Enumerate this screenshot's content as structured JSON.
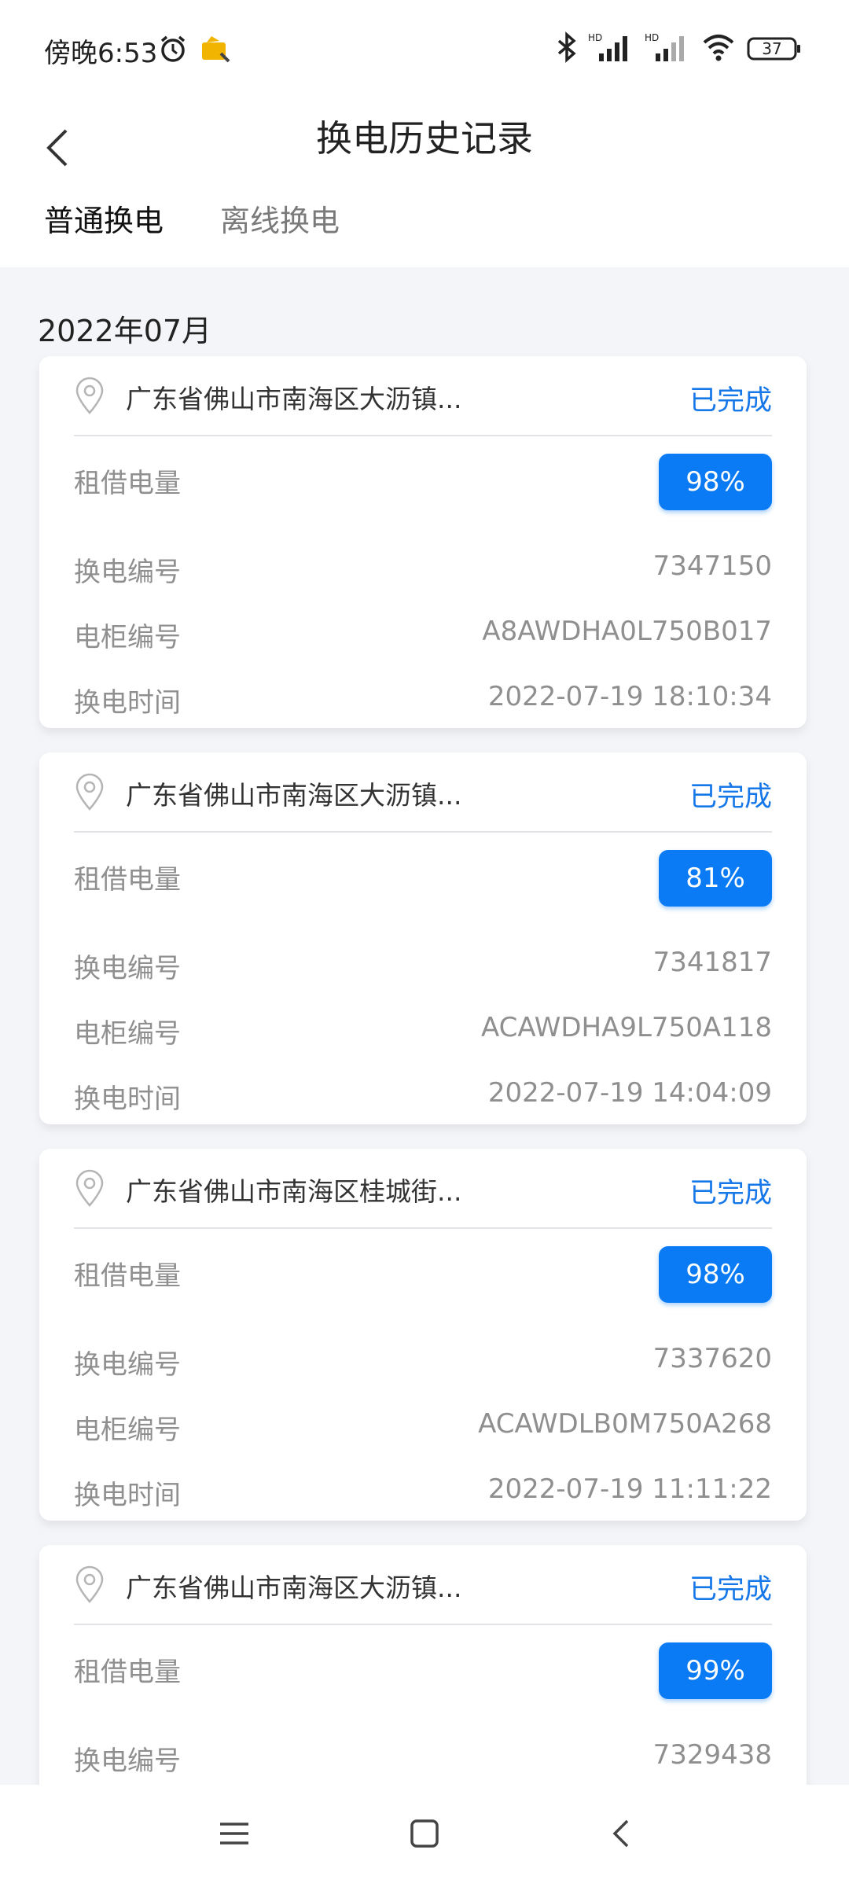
{
  "status_bar": {
    "time": "傍晚6:53",
    "battery": "37",
    "icons": [
      "alarm-icon",
      "app-notification-icon",
      "bluetooth-icon",
      "hd-signal-icon",
      "hd-signal-icon",
      "wifi-icon",
      "battery-icon"
    ]
  },
  "header": {
    "title": "换电历史记录",
    "tabs": [
      {
        "label": "普通换电",
        "active": true
      },
      {
        "label": "离线换电",
        "active": false
      }
    ]
  },
  "month": "2022年07月",
  "records": [
    {
      "address": "广东省佛山市南海区大沥镇...",
      "status": "已完成",
      "rent_label": "租借电量",
      "rent_value": "98%",
      "swap_no_label": "换电编号",
      "swap_no": "7347150",
      "cabinet_label": "电柜编号",
      "cabinet_no": "A8AWDHA0L750B017",
      "time_label": "换电时间",
      "time": "2022-07-19 18:10:34"
    },
    {
      "address": "广东省佛山市南海区大沥镇...",
      "status": "已完成",
      "rent_label": "租借电量",
      "rent_value": "81%",
      "swap_no_label": "换电编号",
      "swap_no": "7341817",
      "cabinet_label": "电柜编号",
      "cabinet_no": "ACAWDHA9L750A118",
      "time_label": "换电时间",
      "time": "2022-07-19 14:04:09"
    },
    {
      "address": "广东省佛山市南海区桂城街...",
      "status": "已完成",
      "rent_label": "租借电量",
      "rent_value": "98%",
      "swap_no_label": "换电编号",
      "swap_no": "7337620",
      "cabinet_label": "电柜编号",
      "cabinet_no": "ACAWDLB0M750A268",
      "time_label": "换电时间",
      "time": "2022-07-19 11:11:22"
    },
    {
      "address": "广东省佛山市南海区大沥镇...",
      "status": "已完成",
      "rent_label": "租借电量",
      "rent_value": "99%",
      "swap_no_label": "换电编号",
      "swap_no": "7329438"
    }
  ],
  "colors": {
    "accent": "#0a7bf5",
    "status_text": "#1677e8",
    "background": "#f3f5f9"
  },
  "nav": [
    "menu-icon",
    "home-icon",
    "back-icon"
  ]
}
